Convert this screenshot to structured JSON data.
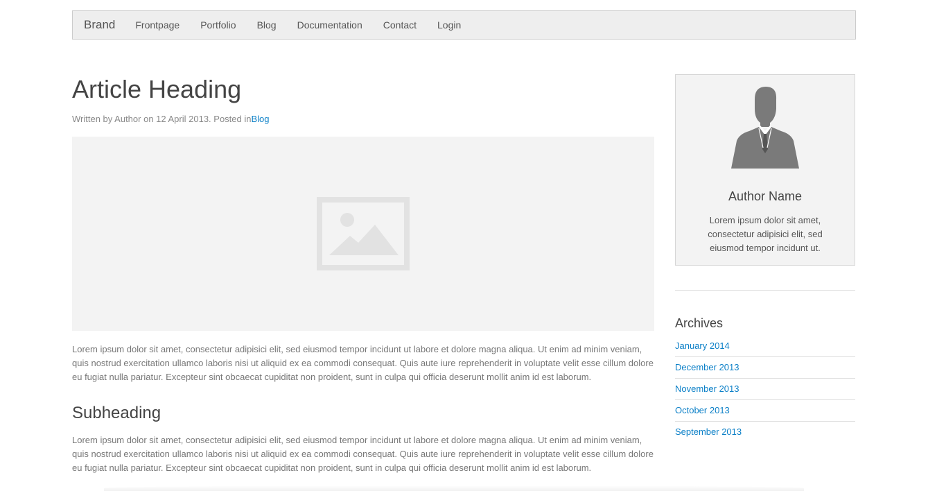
{
  "navbar": {
    "brand": "Brand",
    "items": [
      {
        "label": "Frontpage"
      },
      {
        "label": "Portfolio"
      },
      {
        "label": "Blog"
      },
      {
        "label": "Documentation"
      },
      {
        "label": "Contact"
      },
      {
        "label": "Login"
      }
    ]
  },
  "article": {
    "heading": "Article Heading",
    "meta_prefix": "Written by Author on 12 April 2013. Posted in",
    "meta_category": "Blog",
    "image_icon": "image-placeholder-icon",
    "paragraph1": "Lorem ipsum dolor sit amet, consectetur adipisici elit, sed eiusmod tempor incidunt ut labore et dolore magna aliqua. Ut enim ad minim veniam, quis nostrud exercitation ullamco laboris nisi ut aliquid ex ea commodi consequat. Quis aute iure reprehenderit in voluptate velit esse cillum dolore eu fugiat nulla pariatur. Excepteur sint obcaecat cupiditat non proident, sunt in culpa qui officia deserunt mollit anim id est laborum.",
    "subheading": "Subheading",
    "paragraph2": "Lorem ipsum dolor sit amet, consectetur adipisici elit, sed eiusmod tempor incidunt ut labore et dolore magna aliqua. Ut enim ad minim veniam, quis nostrud exercitation ullamco laboris nisi ut aliquid ex ea commodi consequat. Quis aute iure reprehenderit in voluptate velit esse cillum dolore eu fugiat nulla pariatur. Excepteur sint obcaecat cupiditat non proident, sunt in culpa qui officia deserunt mollit anim id est laborum."
  },
  "sidebar": {
    "author": {
      "avatar_icon": "author-silhouette-icon",
      "name": "Author Name",
      "bio": "Lorem ipsum dolor sit amet, consectetur adipisici elit, sed eiusmod tempor incidunt ut."
    },
    "archives": {
      "title": "Archives",
      "items": [
        {
          "label": "January 2014"
        },
        {
          "label": "December 2013"
        },
        {
          "label": "November 2013"
        },
        {
          "label": "October 2013"
        },
        {
          "label": "September 2013"
        }
      ]
    }
  },
  "colors": {
    "link": "#0a7fc7",
    "navbar_bg": "#eeeeee",
    "card_bg": "#f3f3f3"
  }
}
